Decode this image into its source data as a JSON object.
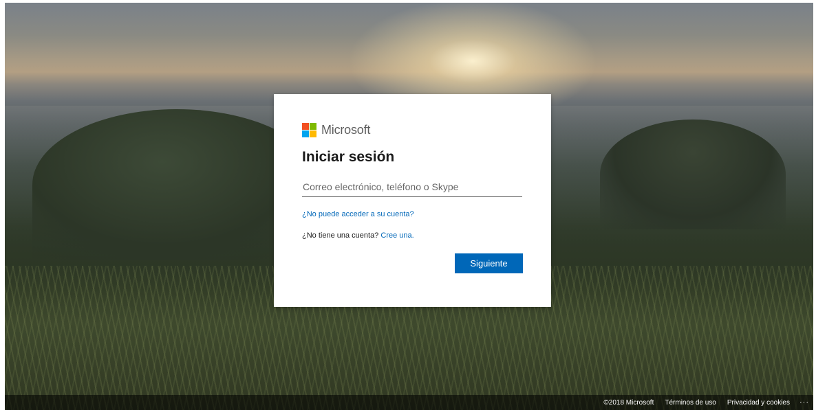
{
  "brand": {
    "name": "Microsoft",
    "logo_colors": [
      "#f25022",
      "#7fba00",
      "#00a4ef",
      "#ffb900"
    ]
  },
  "signin": {
    "title": "Iniciar sesión",
    "input_value": "",
    "input_placeholder": "Correo electrónico, teléfono o Skype",
    "cant_access_link": "¿No puede acceder a su cuenta?",
    "no_account_text": "¿No tiene una cuenta?",
    "create_link": "Cree una.",
    "next_button": "Siguiente"
  },
  "footer": {
    "copyright": "©2018 Microsoft",
    "terms": "Términos de uso",
    "privacy": "Privacidad y cookies",
    "more": "···"
  },
  "colors": {
    "accent": "#0067b8",
    "text": "#1b1b1b"
  }
}
